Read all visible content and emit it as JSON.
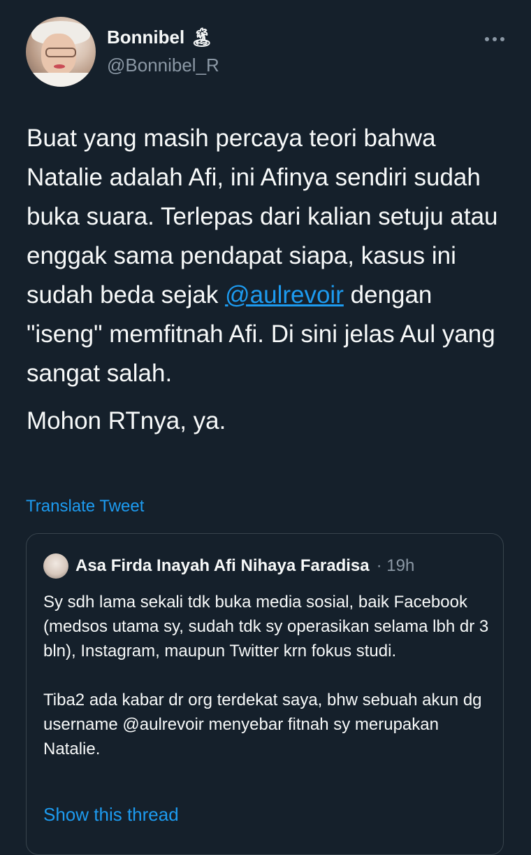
{
  "author": {
    "name": "Bonnibel",
    "name_emoji": "🏝",
    "handle": "@Bonnibel_R",
    "avatar_icon": "profile-photo"
  },
  "more_icon": "more-options-icon",
  "tweet": {
    "text_before_mention": "Buat yang masih percaya teori bahwa Natalie adalah Afi, ini Afinya sendiri sudah buka suara. Terlepas dari kalian setuju atau enggak sama pendapat siapa, kasus ini sudah beda sejak ",
    "mention": "@aulrevoir",
    "text_after_mention": " dengan \"iseng\" memfitnah Afi. Di sini jelas Aul yang sangat salah.",
    "paragraph2": "Mohon RTnya, ya."
  },
  "translate_label": "Translate Tweet",
  "quote": {
    "name": "Asa Firda Inayah Afi Nihaya Faradisa",
    "time": "· 19h",
    "paragraph1": "Sy sdh lama sekali tdk buka media sosial, baik Facebook (medsos utama sy, sudah tdk sy operasikan selama lbh dr 3 bln), Instagram, maupun Twitter krn fokus studi.",
    "paragraph2": "Tiba2 ada kabar dr org terdekat saya, bhw sebuah akun dg username @aulrevoir menyebar fitnah sy merupakan Natalie.",
    "show_thread": "Show this thread"
  },
  "colors": {
    "background": "#15202b",
    "text": "#f7f9f9",
    "secondary": "#8b98a5",
    "accent": "#1d9bf0",
    "border": "#38444d"
  }
}
